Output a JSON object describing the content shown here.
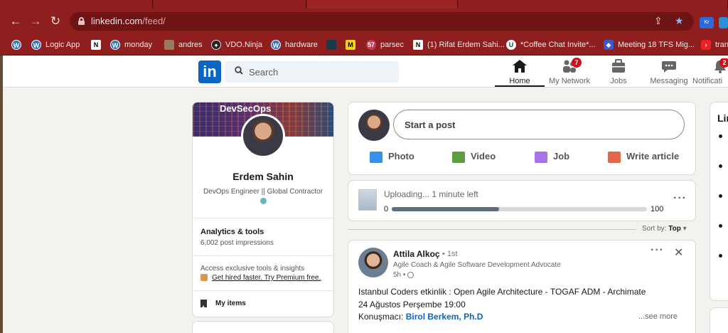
{
  "browser": {
    "url_host": "linkedin.com",
    "url_path": "/feed/",
    "bookmarks": [
      {
        "label": "",
        "icon": "wordpress-icon"
      },
      {
        "label": "Logic App",
        "icon": "wordpress-icon"
      },
      {
        "label": "",
        "icon": "notion-icon"
      },
      {
        "label": "monday",
        "icon": "wordpress-icon"
      },
      {
        "label": "andres",
        "icon": "profile-picture-icon"
      },
      {
        "label": "VDO.Ninja",
        "icon": "vdo-ninja-icon"
      },
      {
        "label": "hardware",
        "icon": "wordpress-icon"
      },
      {
        "label": "",
        "icon": "app-icon"
      },
      {
        "label": "",
        "icon": "miro-icon"
      },
      {
        "label": "parsec",
        "icon": "parsec-icon"
      },
      {
        "label": "(1) Rifat Erdem Sahi...",
        "icon": "notion-icon"
      },
      {
        "label": "*Coffee Chat Invite*...",
        "icon": "u-icon"
      },
      {
        "label": "Meeting 18 TFS Mig...",
        "icon": "shield-icon"
      },
      {
        "label": "trans",
        "icon": "youtube-icon"
      }
    ]
  },
  "nav": {
    "search_placeholder": "Search",
    "items": [
      {
        "label": "Home",
        "badge": ""
      },
      {
        "label": "My Network",
        "badge": "7"
      },
      {
        "label": "Jobs",
        "badge": ""
      },
      {
        "label": "Messaging",
        "badge": ""
      },
      {
        "label": "Notificati",
        "badge": "2"
      }
    ]
  },
  "profile": {
    "banner_text": "DevSecOps",
    "name": "Erdem Sahin",
    "title": "DevOps Engineer || Global Contractor",
    "analytics_label": "Analytics & tools",
    "analytics_value": "6,002 post impressions",
    "premium_text": "Access exclusive tools & insights",
    "premium_link": "Get hired faster. Try Premium free.",
    "my_items": "My items"
  },
  "compose": {
    "start_post": "Start a post",
    "actions": [
      "Photo",
      "Video",
      "Job",
      "Write article"
    ]
  },
  "upload": {
    "status": "Uploading... 1 minute left",
    "min": "0",
    "max": "100",
    "progress_fraction": 0.42
  },
  "feed": {
    "sort_label": "Sort by:",
    "sort_value": "Top"
  },
  "post": {
    "author": "Attila Alkoç",
    "degree": "• 1st",
    "subtitle": "Agile Coach & Agile Software Development Advocate",
    "time": "5h •",
    "line1": "Istanbul Coders etkinlik : Open Agile Architecture - TOGAF ADM - Archimate",
    "line2": "24 Ağustos Perşembe 19:00",
    "line3_prefix": "Konuşmacı:",
    "line3_link": "Birol Berkem, Ph.D",
    "see_more": "...see more"
  },
  "right": {
    "title": "Lin"
  }
}
